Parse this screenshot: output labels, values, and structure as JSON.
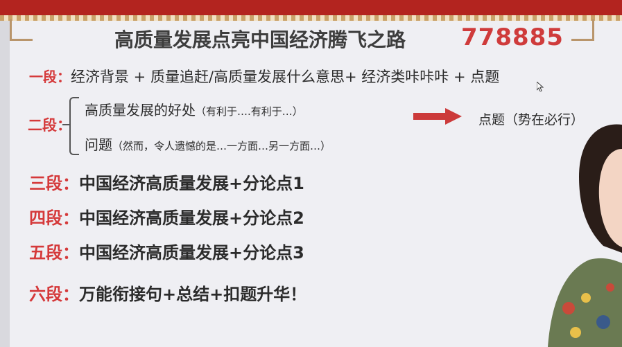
{
  "slide": {
    "title": "高质量发展点亮中国经济腾飞之路",
    "code": "778885",
    "row1": {
      "label": "一段：",
      "text": "经济背景 + 质量追赶/高质量发展什么意思+ 经济类咔咔咔 + 点题"
    },
    "row2": {
      "label": "二段：",
      "line1_main": "高质量发展的好处",
      "line1_note": "（有利于….有利于…）",
      "line2_main": "问题",
      "line2_note": "（然而，令人遗憾的是…一方面…另一方面…）",
      "conclusion": "点题（势在必行）"
    },
    "row3": {
      "label": "三段：",
      "text": "中国经济高质量发展+分论点1"
    },
    "row4": {
      "label": "四段：",
      "text": "中国经济高质量发展+分论点2"
    },
    "row5": {
      "label": "五段：",
      "text": "中国经济高质量发展+分论点3"
    },
    "row6": {
      "label": "六段：",
      "text": "万能衔接句+总结+扣题升华！"
    }
  },
  "colors": {
    "accent_red": "#d5393a",
    "code_red": "#cf3b3b",
    "frame_red": "#b3241f",
    "arrow_red": "#cc3a3a"
  }
}
